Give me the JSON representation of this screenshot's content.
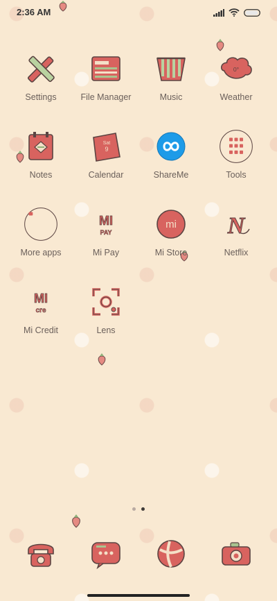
{
  "status": {
    "time": "2:36 AM",
    "battery_icon": "battery-icon",
    "wifi_icon": "wifi-icon",
    "signal_icon": "signal-icon"
  },
  "colors": {
    "background": "#f9e9d2",
    "icon_fill": "#d8635f",
    "icon_outline": "#5b4442",
    "label": "#6a5f5a",
    "shareme_blue": "#1e9be8"
  },
  "apps": [
    {
      "label": "Settings",
      "icon": "settings-icon"
    },
    {
      "label": "File Manager",
      "icon": "file-manager-icon"
    },
    {
      "label": "Music",
      "icon": "music-icon"
    },
    {
      "label": "Weather",
      "icon": "weather-icon",
      "icon_text": "0°"
    },
    {
      "label": "Notes",
      "icon": "notes-icon"
    },
    {
      "label": "Calendar",
      "icon": "calendar-icon",
      "icon_text_top": "Sat",
      "icon_text_bottom": "9"
    },
    {
      "label": "ShareMe",
      "icon": "shareme-icon"
    },
    {
      "label": "Tools",
      "icon": "tools-folder-icon"
    },
    {
      "label": "More apps",
      "icon": "more-apps-folder-icon"
    },
    {
      "label": "Mi Pay",
      "icon": "mi-pay-icon",
      "icon_text_top": "MI",
      "icon_text_bottom": "PAY"
    },
    {
      "label": "Mi Store",
      "icon": "mi-store-icon",
      "icon_text": "mi"
    },
    {
      "label": "Netflix",
      "icon": "netflix-icon",
      "icon_text": "N"
    },
    {
      "label": "Mi Credit",
      "icon": "mi-credit-icon",
      "icon_text_top": "MI",
      "icon_text_bottom": "cre"
    },
    {
      "label": "Lens",
      "icon": "lens-icon"
    }
  ],
  "page_indicator": {
    "pages": 2,
    "current": 2
  },
  "dock": [
    {
      "icon": "phone-icon"
    },
    {
      "icon": "messages-icon"
    },
    {
      "icon": "browser-icon"
    },
    {
      "icon": "camera-icon"
    }
  ]
}
